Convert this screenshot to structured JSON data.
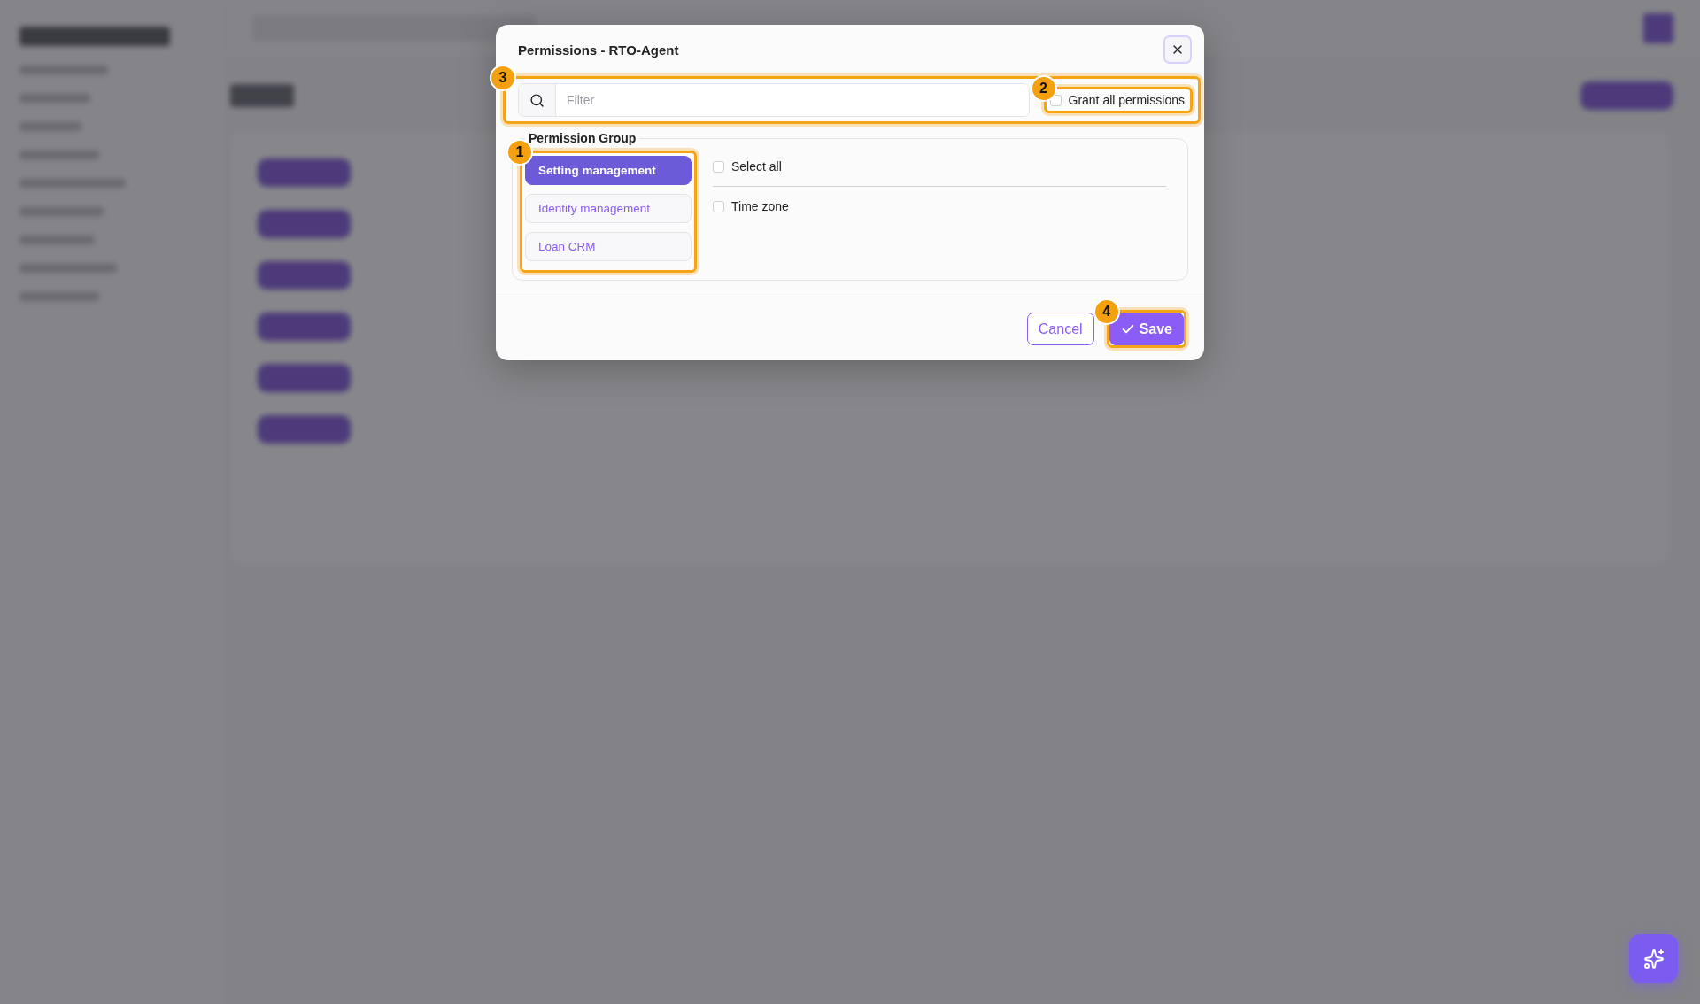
{
  "dialog": {
    "title": "Permissions - RTO-Agent",
    "toolbar": {
      "callout": "3",
      "filter": {
        "placeholder": "Filter"
      },
      "grant_all": {
        "label": "Grant all permissions",
        "checked": false,
        "callout": "2"
      }
    },
    "permission_group": {
      "legend": "Permission Group",
      "callout": "1",
      "groups": [
        {
          "label": "Setting management",
          "selected": true
        },
        {
          "label": "Identity management",
          "selected": false
        },
        {
          "label": "Loan CRM",
          "selected": false
        }
      ],
      "select_all": {
        "label": "Select all",
        "checked": false
      },
      "permissions": [
        {
          "label": "Time zone",
          "checked": false
        }
      ]
    },
    "buttons": [
      {
        "kind": "cancel",
        "label": "Cancel"
      },
      {
        "kind": "save",
        "label": "Save",
        "callout": "4"
      }
    ]
  }
}
